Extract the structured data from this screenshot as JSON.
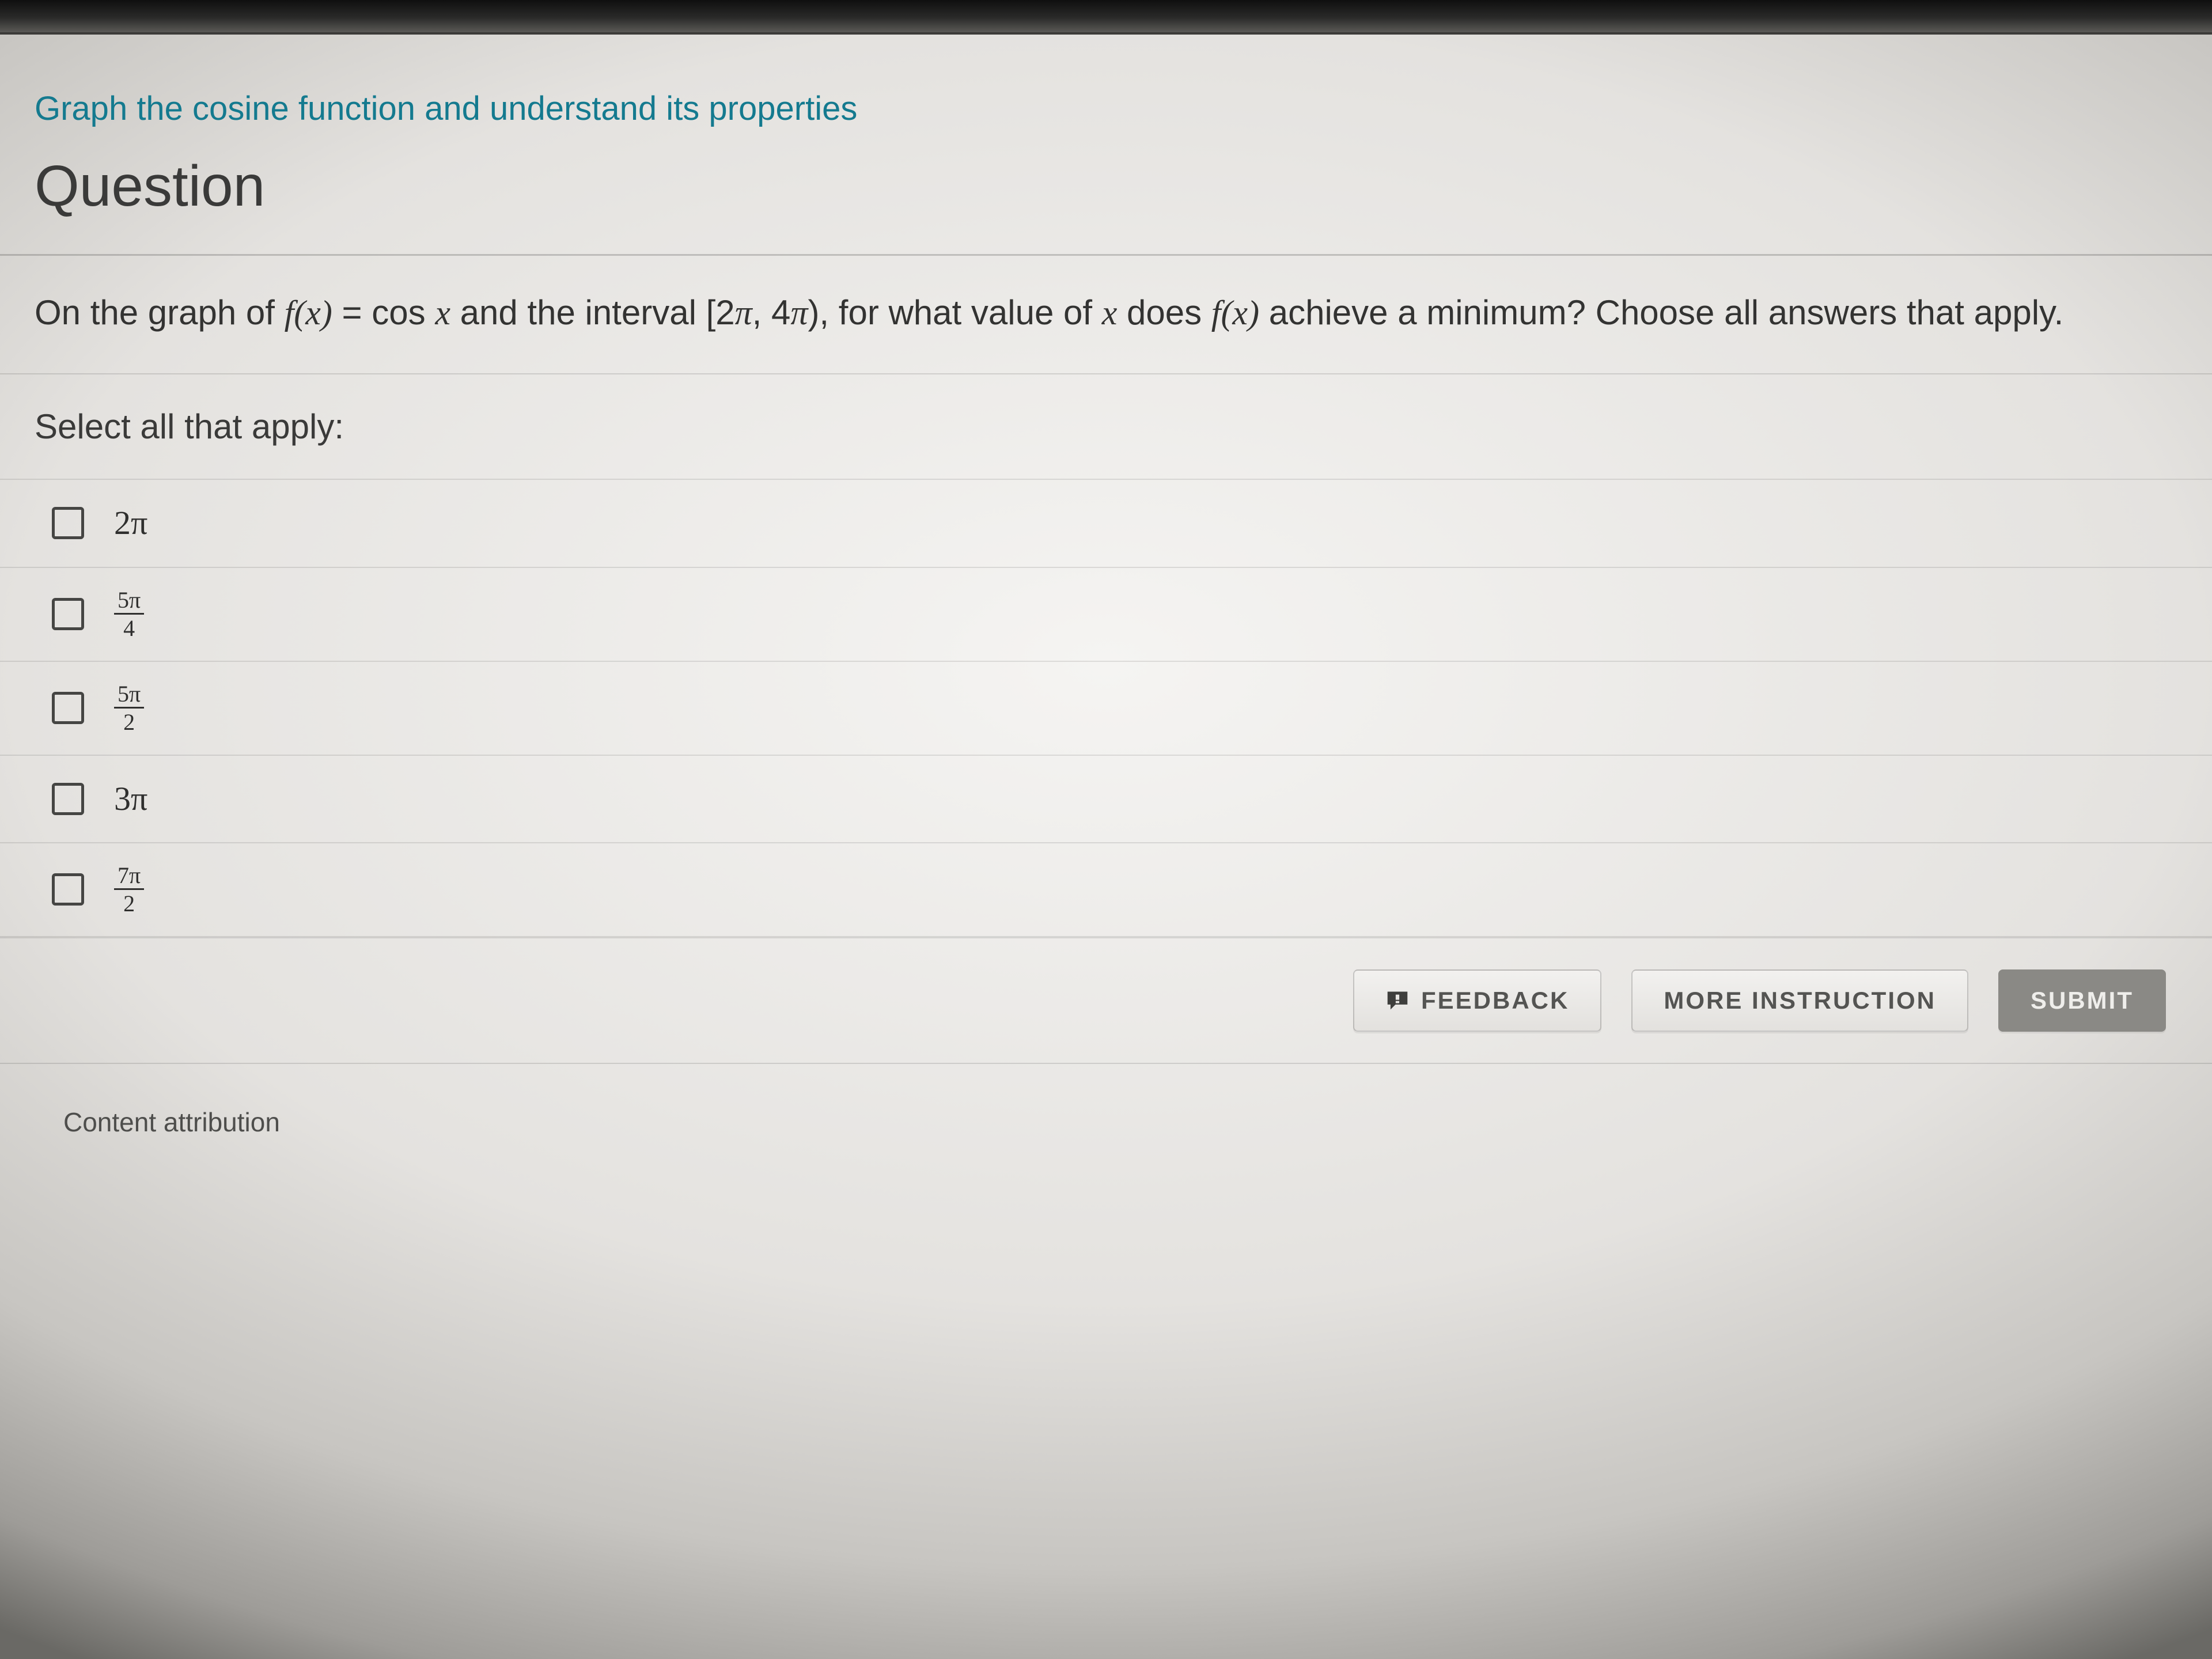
{
  "topic": "Graph the cosine function and understand its properties",
  "heading": "Question",
  "prompt": {
    "pre": "On the graph of ",
    "fx": "f(x)",
    "eq": " = cos ",
    "x1": "x",
    "mid": " and the interval [2",
    "pi1": "π",
    "comma": ", 4",
    "pi2": "π",
    "close": "), for what value of ",
    "x2": "x",
    "does": " does ",
    "fx2": "f(x)",
    "tail": " achieve a minimum? Choose all answers that apply."
  },
  "instruction": "Select all that apply:",
  "options": [
    {
      "type": "plain",
      "text": "2π"
    },
    {
      "type": "frac",
      "num": "5π",
      "den": "4"
    },
    {
      "type": "frac",
      "num": "5π",
      "den": "2"
    },
    {
      "type": "plain",
      "text": "3π"
    },
    {
      "type": "frac",
      "num": "7π",
      "den": "2"
    }
  ],
  "buttons": {
    "feedback": "FEEDBACK",
    "more": "MORE INSTRUCTION",
    "submit": "SUBMIT"
  },
  "attribution": "Content attribution"
}
